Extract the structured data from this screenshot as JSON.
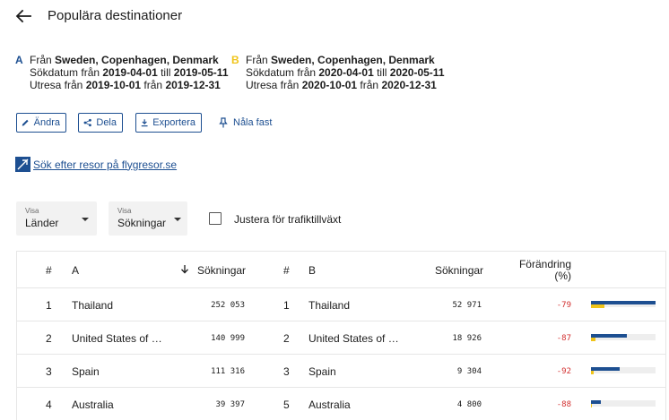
{
  "header": {
    "back_icon": "arrow-left-icon",
    "title": "Populära destinationer"
  },
  "query_a": {
    "letter": "A",
    "from_prefix": "Från ",
    "origin": "Sweden, Copenhagen, Denmark",
    "search_prefix": "Sökdatum från ",
    "search_from": "2019-04-01",
    "search_mid": " till ",
    "search_to": "2019-05-11",
    "out_prefix": "Utresa från ",
    "out_from": "2019-10-01",
    "out_mid": " från ",
    "out_to": "2019-12-31"
  },
  "query_b": {
    "letter": "B",
    "from_prefix": "Från ",
    "origin": "Sweden, Copenhagen, Denmark",
    "search_prefix": "Sökdatum från ",
    "search_from": "2020-04-01",
    "search_mid": " till ",
    "search_to": "2020-05-11",
    "out_prefix": "Utresa från ",
    "out_from": "2020-10-01",
    "out_mid": " från ",
    "out_to": "2020-12-31"
  },
  "actions": {
    "edit": "Ändra",
    "share": "Dela",
    "export": "Exportera",
    "pin": "Nåla fast"
  },
  "search_link": "Sök efter resor på flygresor.se",
  "filters": {
    "show_label_1": "Visa",
    "show_value_1": "Länder",
    "show_label_2": "Visa",
    "show_value_2": "Sökningar",
    "adjust_label": "Justera för trafiktillväxt",
    "adjust_checked": false
  },
  "table": {
    "headers": {
      "rank_a": "#",
      "name_a": "A",
      "searches_a": "Sökningar",
      "rank_b": "#",
      "name_b": "B",
      "searches_b": "Sökningar",
      "change": "Förändring (%)"
    },
    "rows": [
      {
        "rank_a": "1",
        "name_a": "Thailand",
        "searches_a": "252 053",
        "rank_b": "1",
        "name_b": "Thailand",
        "searches_b": "52 971",
        "change": "-79",
        "bar_a": 1.0,
        "bar_b": 0.21
      },
      {
        "rank_a": "2",
        "name_a": "United States of …",
        "searches_a": "140 999",
        "rank_b": "2",
        "name_b": "United States of …",
        "searches_b": "18 926",
        "change": "-87",
        "bar_a": 0.56,
        "bar_b": 0.075
      },
      {
        "rank_a": "3",
        "name_a": "Spain",
        "searches_a": "111 316",
        "rank_b": "3",
        "name_b": "Spain",
        "searches_b": "9 304",
        "change": "-92",
        "bar_a": 0.44,
        "bar_b": 0.037
      },
      {
        "rank_a": "4",
        "name_a": "Australia",
        "searches_a": "39 397",
        "rank_b": "5",
        "name_b": "Australia",
        "searches_b": "4 800",
        "change": "-88",
        "bar_a": 0.156,
        "bar_b": 0.019
      }
    ]
  },
  "colors": {
    "accent": "#1d4f91",
    "series_a": "#1d4f91",
    "series_b": "#f0c419",
    "negative": "#d22f2f"
  }
}
